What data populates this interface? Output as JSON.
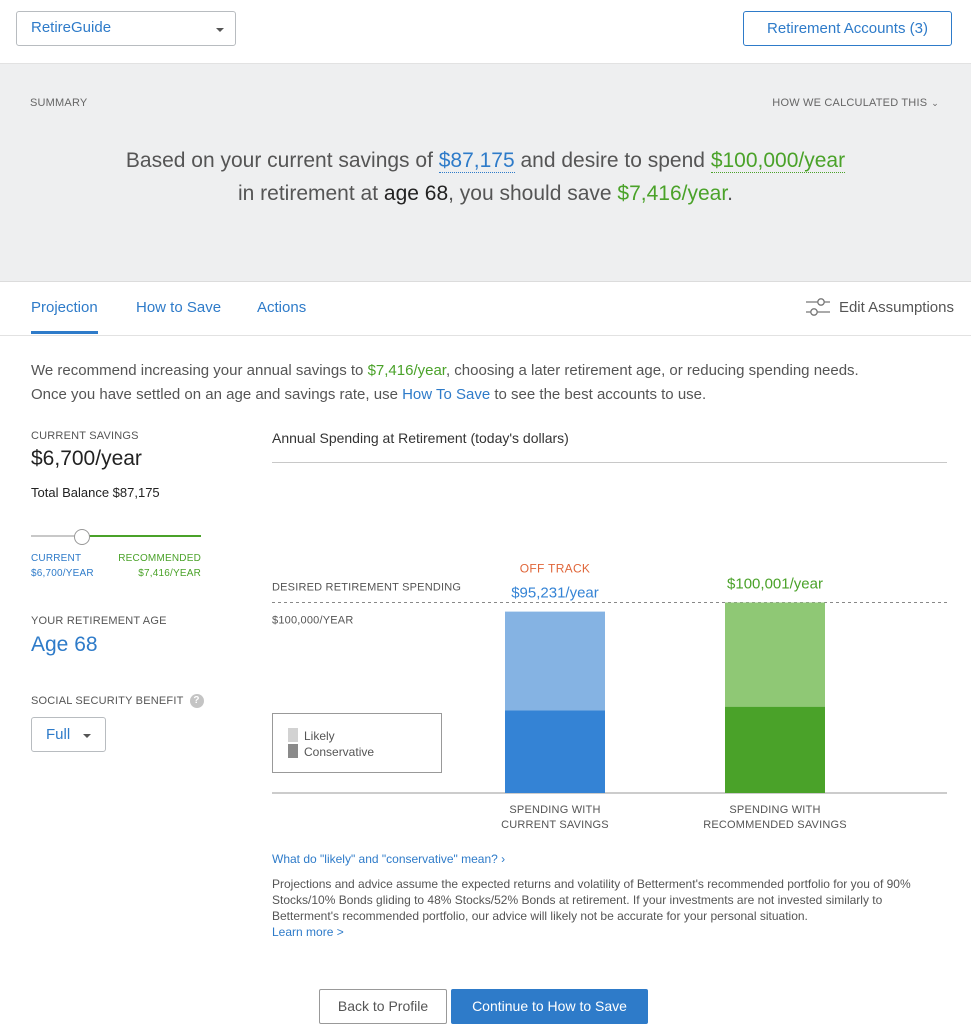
{
  "topbar": {
    "goal_select_value": "RetireGuide",
    "accounts_button": "Retirement Accounts (3)"
  },
  "summary": {
    "label": "SUMMARY",
    "how_calculated": "HOW WE CALCULATED THIS",
    "line1_a": "Based on your current savings of ",
    "current_savings": "$87,175",
    "line1_b": " and desire to spend ",
    "desired_spend": "$100,000/year",
    "line2_a": "in retirement at ",
    "age": "age 68",
    "line2_b": ", you should save ",
    "should_save": "$7,416/year",
    "line2_c": "."
  },
  "tabs": {
    "projection": "Projection",
    "how_to_save": "How to Save",
    "actions": "Actions",
    "edit_assumptions": "Edit Assumptions"
  },
  "recommendation": {
    "part1": "We recommend increasing your annual savings to ",
    "amount": "$7,416/year",
    "part2": ", choosing a later retirement age, or reducing spending needs.",
    "part3": "Once you have settled on an age and savings rate, use ",
    "link": "How To Save",
    "part4": " to see the best accounts to use."
  },
  "left": {
    "current_savings_label": "CURRENT SAVINGS",
    "current_savings_value": "$6,700/year",
    "total_balance": "Total Balance $87,175",
    "slider_current_label": "CURRENT",
    "slider_current_value": "$6,700/YEAR",
    "slider_recommended_label": "RECOMMENDED",
    "slider_recommended_value": "$7,416/YEAR",
    "slider_position": 0.3,
    "retirement_age_label": "YOUR RETIREMENT AGE",
    "retirement_age_value": "Age 68",
    "ss_label": "SOCIAL SECURITY BENEFIT",
    "ss_help": "?",
    "ss_value": "Full"
  },
  "chart_data": {
    "type": "bar",
    "title": "Annual Spending at Retirement (today's dollars)",
    "desired_label": "DESIRED RETIREMENT SPENDING",
    "desired_value_label": "$100,000/YEAR",
    "desired": 100000,
    "ylim": [
      0,
      105000
    ],
    "status_label": "OFF TRACK",
    "categories": [
      "SPENDING WITH\nCURRENT SAVINGS",
      "SPENDING WITH\nRECOMMENDED SAVINGS"
    ],
    "value_labels": [
      "$95,231/year",
      "$100,001/year"
    ],
    "series": [
      {
        "name": "Conservative",
        "values": [
          43300,
          45200
        ]
      },
      {
        "name": "Likely",
        "values": [
          95231,
          100001
        ]
      }
    ],
    "colors": {
      "current_likely": "#85b3e3",
      "current_conservative": "#3483d5",
      "recommended_likely": "#8fc875",
      "recommended_conservative": "#4aa229",
      "off_track": "#e0663a",
      "legend_likely": "#d2d2d2",
      "legend_conservative": "#8a8a8a"
    },
    "legend": [
      "Likely",
      "Conservative"
    ]
  },
  "footer": {
    "faq_link": "What do \"likely\" and \"conservative\" mean? ›",
    "disclaimer": "Projections and advice assume the expected returns and volatility of Betterment's recommended portfolio for you of 90% Stocks/10% Bonds gliding to 48% Stocks/52% Bonds at retirement. If your investments are not invested similarly to Betterment's recommended portfolio, our advice will likely not be accurate for your personal situation.",
    "learn_more": "Learn more >",
    "back_button": "Back to Profile",
    "continue_button": "Continue to How to Save"
  }
}
